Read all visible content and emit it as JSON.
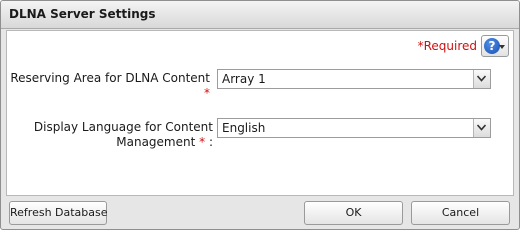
{
  "dialog": {
    "title": "DLNA Server Settings"
  },
  "form": {
    "required_note": "*Required",
    "help_icon_glyph": "?",
    "fields": [
      {
        "label": "Reserving Area for DLNA Content",
        "required_mark": "*",
        "value": "Array 1"
      },
      {
        "label_line1": "Display Language for Content",
        "label_line2": "Management",
        "required_mark": "*",
        "suffix": " :",
        "value": "English"
      }
    ]
  },
  "footer": {
    "refresh_label": "Refresh Database",
    "ok_label": "OK",
    "cancel_label": "Cancel"
  },
  "colors": {
    "required": "#d01010",
    "help_icon": "#1a4fb4"
  },
  "icons": {
    "help": "help-icon",
    "dropdown": "chevron-down-icon"
  }
}
